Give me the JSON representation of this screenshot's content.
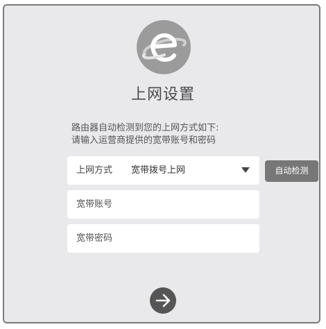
{
  "page": {
    "title": "上网设置",
    "description_line1": "路由器自动检测到您的上网方式如下:",
    "description_line2": "请输入运营商提供的宽带账号和密码"
  },
  "form": {
    "connection_type_label": "上网方式",
    "connection_type_value": "宽带拨号上网",
    "auto_detect_label": "自动检测",
    "account_placeholder": "宽带账号",
    "password_placeholder": "宽带密码"
  },
  "icons": {
    "logo": "planet-logo-icon",
    "connection_dropdown": "triangle-down-icon",
    "next": "arrow-right-icon"
  },
  "colors": {
    "background": "#e9e9ec",
    "border": "#7a7a7a",
    "logo_circle": "#9b9b9b",
    "detect_button": "#777777",
    "next_button": "#555555",
    "field_background": "#ffffff"
  }
}
